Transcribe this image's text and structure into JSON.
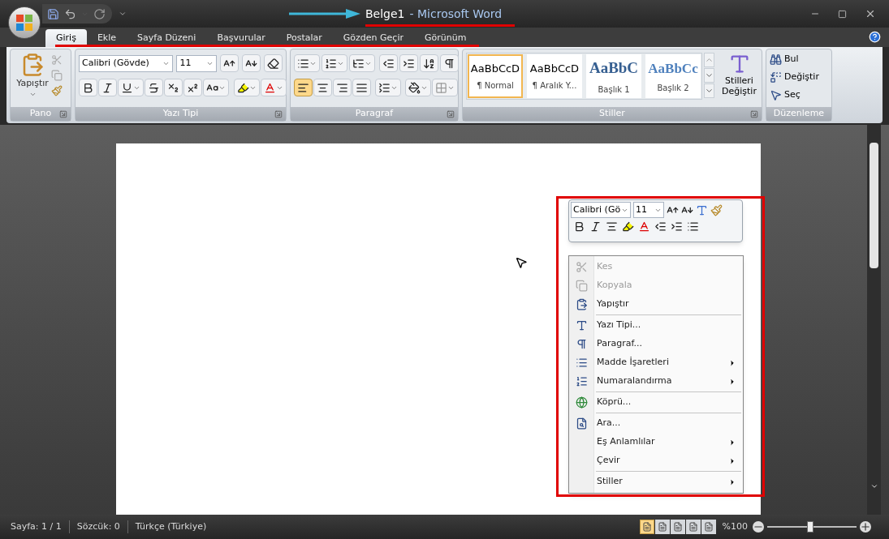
{
  "window": {
    "title_doc": "Belge1",
    "title_app": "- Microsoft Word"
  },
  "tabs": [
    {
      "label": "Giriş",
      "selected": true
    },
    {
      "label": "Ekle",
      "selected": false
    },
    {
      "label": "Sayfa Düzeni",
      "selected": false
    },
    {
      "label": "Başvurular",
      "selected": false
    },
    {
      "label": "Postalar",
      "selected": false
    },
    {
      "label": "Gözden Geçir",
      "selected": false
    },
    {
      "label": "Görünüm",
      "selected": false
    }
  ],
  "ribbon": {
    "clipboard": {
      "paste": "Yapıştır",
      "label": "Pano"
    },
    "font": {
      "face": "Calibri (Gövde)",
      "size": "11",
      "label": "Yazı Tipi"
    },
    "paragraph": {
      "label": "Paragraf",
      "alignments": [
        {
          "kind": "left",
          "selected": true
        },
        {
          "kind": "center",
          "selected": false
        },
        {
          "kind": "right",
          "selected": false
        },
        {
          "kind": "justify",
          "selected": false
        }
      ]
    },
    "styles": {
      "items": [
        {
          "preview": "AaBbCcD",
          "name": "¶ Normal",
          "kind": "body",
          "selected": true
        },
        {
          "preview": "AaBbCcD",
          "name": "¶ Aralık Y...",
          "kind": "body",
          "selected": false
        },
        {
          "preview": "AaBbC",
          "name": "Başlık 1",
          "kind": "heading1",
          "selected": false
        },
        {
          "preview": "AaBbCc",
          "name": "Başlık 2",
          "kind": "heading2",
          "selected": false
        }
      ],
      "change": [
        "Stilleri",
        "Değiştir"
      ],
      "label": "Stiller"
    },
    "editing": {
      "items": [
        {
          "label": "Bul",
          "kind": "find"
        },
        {
          "label": "Değiştir",
          "kind": "replace"
        },
        {
          "label": "Seç",
          "kind": "select"
        }
      ],
      "label": "Düzenleme"
    }
  },
  "mini_toolbar": {
    "face": "Calibri (Gö",
    "size": "11"
  },
  "context_menu": [
    {
      "label": "Kes",
      "kind": "cut",
      "disabled": true,
      "submenu": false,
      "separator_before": false
    },
    {
      "label": "Kopyala",
      "kind": "copy",
      "disabled": true,
      "submenu": false,
      "separator_before": false
    },
    {
      "label": "Yapıştır",
      "kind": "paste",
      "disabled": false,
      "submenu": false,
      "separator_before": false
    },
    {
      "label": "Yazı Tipi...",
      "kind": "font",
      "disabled": false,
      "submenu": false,
      "separator_before": true
    },
    {
      "label": "Paragraf...",
      "kind": "paragraph",
      "disabled": false,
      "submenu": false,
      "separator_before": false
    },
    {
      "label": "Madde İşaretleri",
      "kind": "bullets",
      "disabled": false,
      "submenu": true,
      "separator_before": false
    },
    {
      "label": "Numaralandırma",
      "kind": "numbering",
      "disabled": false,
      "submenu": true,
      "separator_before": false
    },
    {
      "label": "Köprü...",
      "kind": "link",
      "disabled": false,
      "submenu": false,
      "separator_before": true
    },
    {
      "label": "Ara...",
      "kind": "search",
      "disabled": false,
      "submenu": false,
      "separator_before": true
    },
    {
      "label": "Eş Anlamlılar",
      "kind": "none",
      "disabled": false,
      "submenu": true,
      "separator_before": false
    },
    {
      "label": "Çevir",
      "kind": "none",
      "disabled": false,
      "submenu": true,
      "separator_before": false
    },
    {
      "label": "Stiller",
      "kind": "none",
      "disabled": false,
      "submenu": true,
      "separator_before": true
    }
  ],
  "status_bar": {
    "items": [
      "Sayfa: 1 / 1",
      "Sözcük: 0",
      "Türkçe (Türkiye)"
    ],
    "views": [
      {
        "selected": true
      },
      {
        "selected": false
      },
      {
        "selected": false
      },
      {
        "selected": false
      },
      {
        "selected": false
      }
    ],
    "zoom": {
      "reading": "%100",
      "level": 0.48
    }
  }
}
